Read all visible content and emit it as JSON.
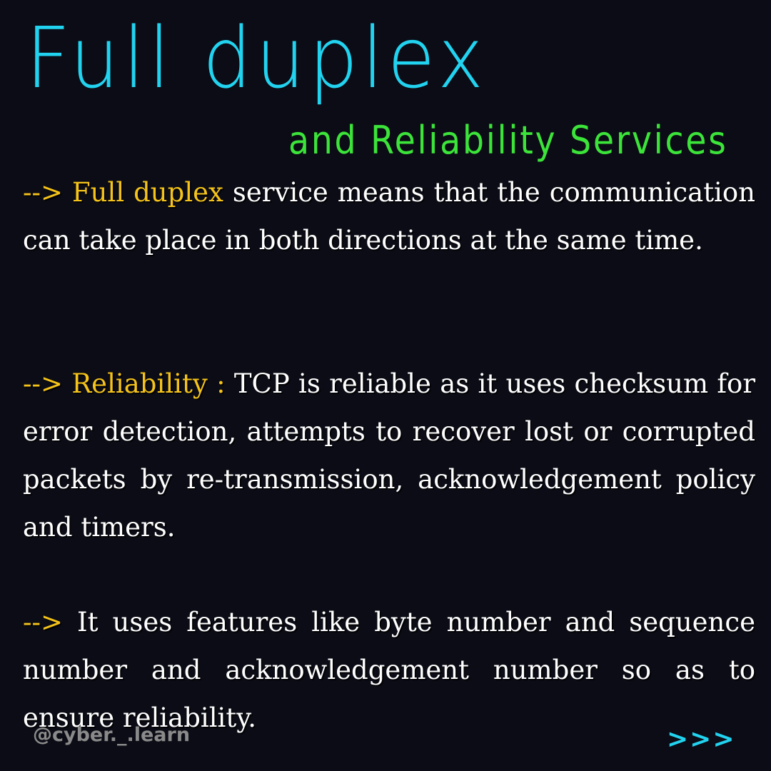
{
  "title": "Full duplex",
  "subtitle": "and Reliability Services",
  "paragraphs": [
    {
      "arrow": "-->",
      "highlight": "Full duplex",
      "text": " service means that the communication can take place in both directions at the same time."
    },
    {
      "arrow": "-->",
      "highlight": "Reliability :",
      "text": " TCP is reliable as it uses checksum for error detection, attempts to recover lost or corrupted packets by re-transmission, acknowledgement policy and timers."
    },
    {
      "arrow": "-->",
      "text": " It uses features like byte number and sequence number and acknowledgement number so as to ensure reliability."
    }
  ],
  "footer": {
    "handle": "@cyber._.learn",
    "next_label": ">>>"
  },
  "colors": {
    "background": "#0b0c15",
    "title": "#22d3f0",
    "subtitle": "#3ce43a",
    "highlight": "#f5c31a",
    "body_text": "#ffffff"
  }
}
